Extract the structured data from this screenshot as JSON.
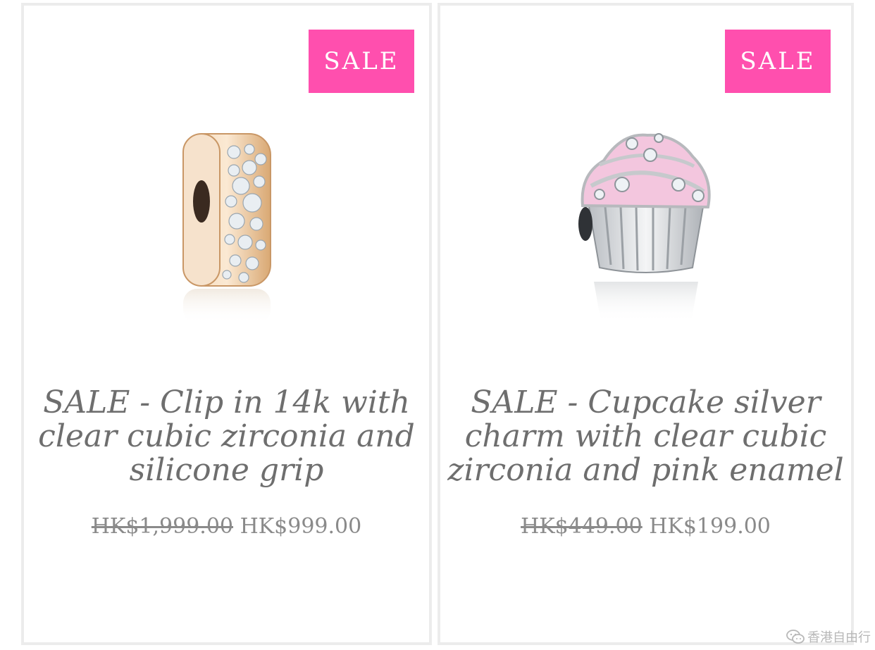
{
  "products": [
    {
      "badge": "SALE",
      "title": "SALE - Clip in 14k with clear cubic zirconia and silicone grip",
      "price_old": "HK$1,999.00",
      "price_new": "HK$999.00",
      "image_icon": "gold-clip-charm-icon"
    },
    {
      "badge": "SALE",
      "title": "SALE - Cupcake silver charm with clear cubic zirconia and pink enamel",
      "price_old": "HK$449.00",
      "price_new": "HK$199.00",
      "image_icon": "cupcake-charm-icon"
    }
  ],
  "watermark": {
    "text": "香港自由行",
    "icon": "wechat-icon"
  },
  "colors": {
    "badge": "#ff4fae",
    "title_text": "#6e6e6e",
    "price_text": "#8a8a8a",
    "card_border": "#ececec"
  }
}
